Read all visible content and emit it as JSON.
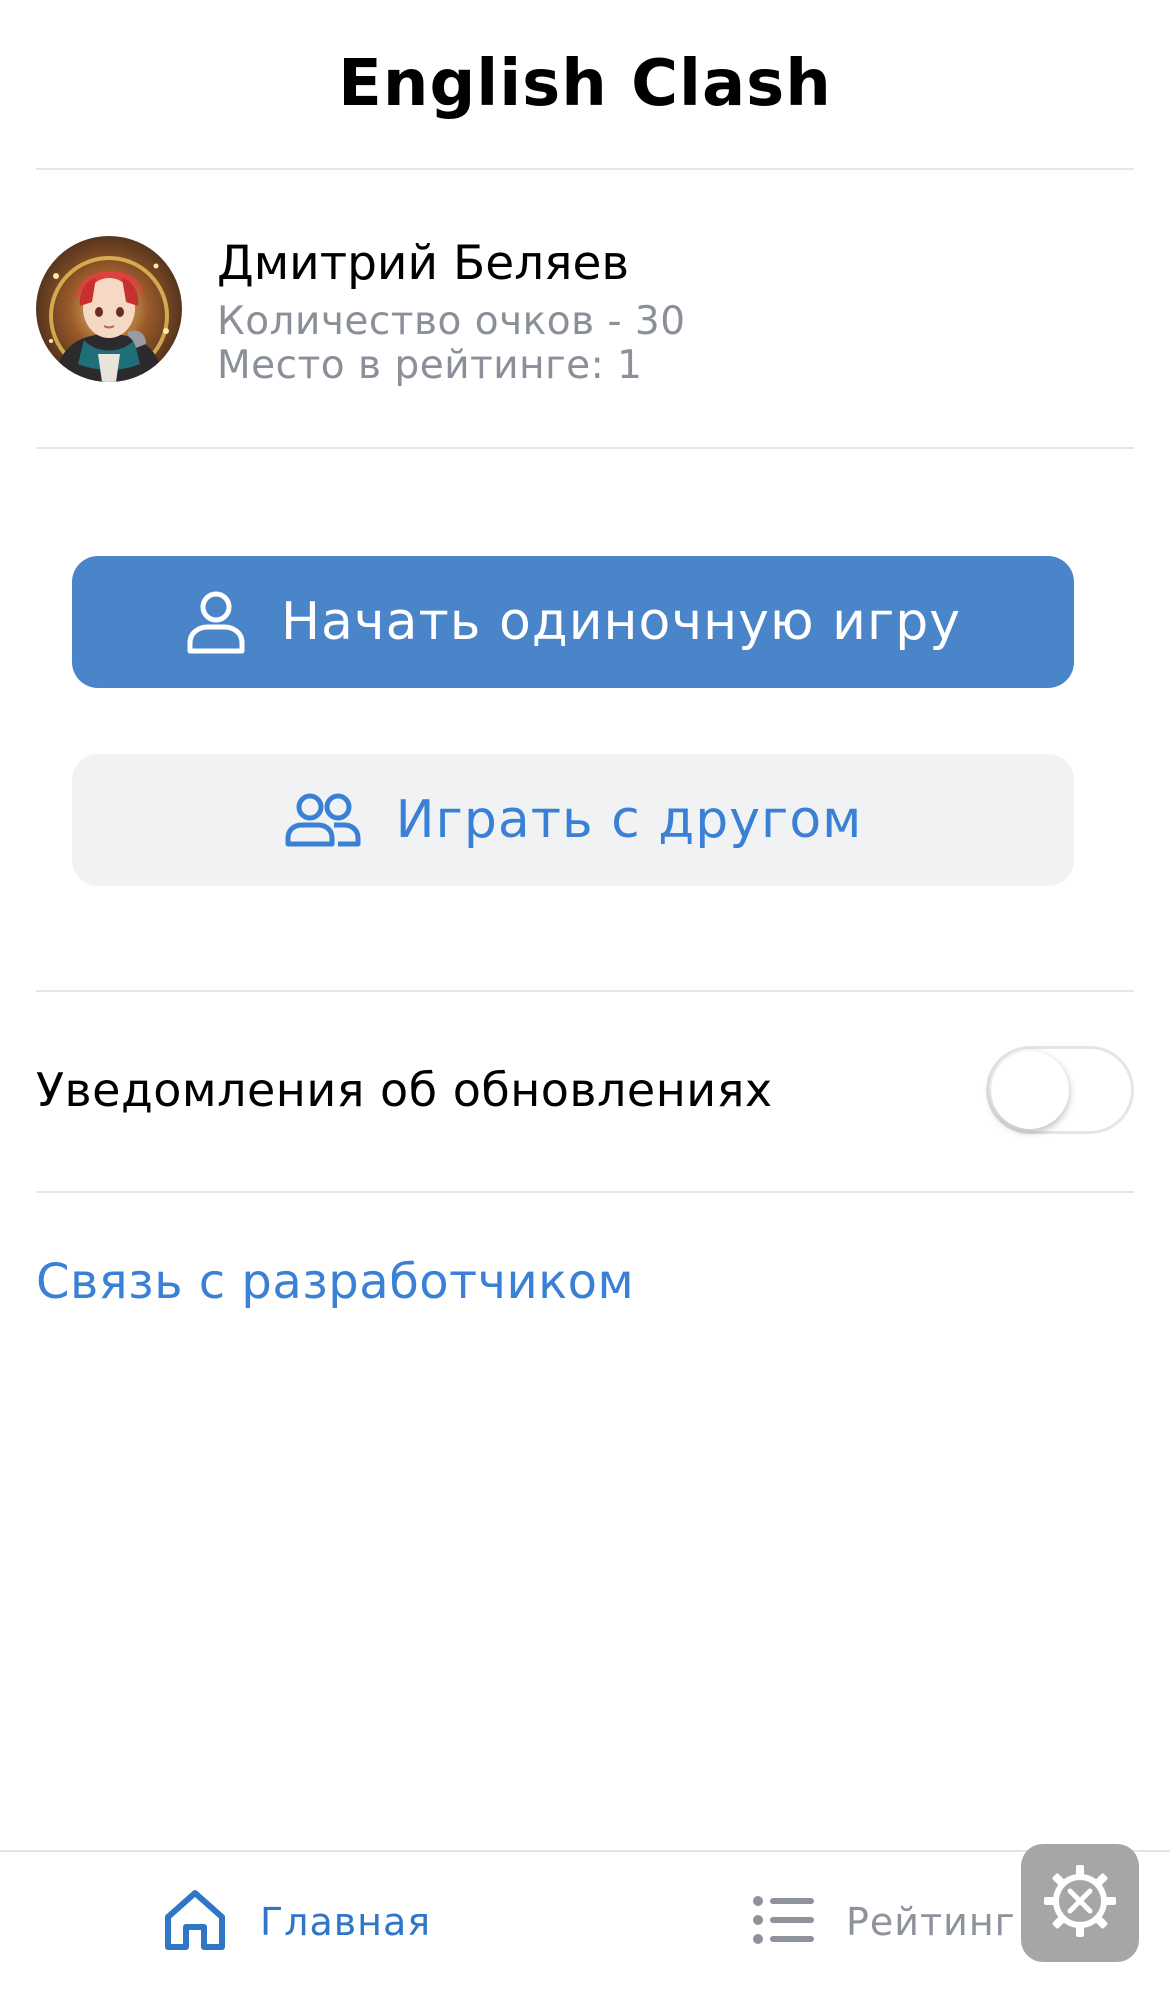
{
  "header": {
    "title": "English Clash"
  },
  "profile": {
    "name": "Дмитрий Беляев",
    "points": "Количество очков - 30",
    "rank": "Место в рейтинге: 1"
  },
  "actions": {
    "single_game": "Начать одиночную игру",
    "play_with_friend": "Играть с другом"
  },
  "settings": {
    "notifications_label": "Уведомления об обновлениях",
    "notifications_enabled": false
  },
  "links": {
    "contact_developer": "Связь с разработчиком"
  },
  "tabbar": {
    "items": [
      {
        "label": "Главная",
        "icon": "home-icon",
        "active": true
      },
      {
        "label": "Рейтинг",
        "icon": "list-icon",
        "active": false
      }
    ]
  },
  "colors": {
    "primary": "#4a85c9",
    "link": "#3a80d4",
    "secondary_bg": "#f1f2f4",
    "muted_text": "#8a8f99"
  }
}
